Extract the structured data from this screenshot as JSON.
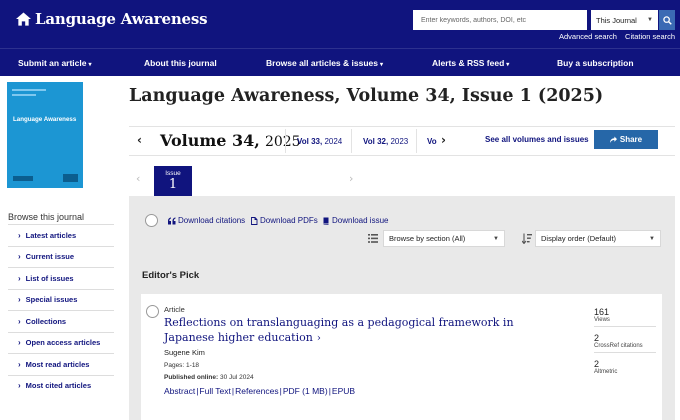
{
  "header": {
    "journal_name": "Language Awareness",
    "search_placeholder": "Enter keywords, authors, DOI, etc",
    "search_scope": "This Journal",
    "advanced_search": "Advanced search",
    "citation_search": "Citation search"
  },
  "nav": [
    {
      "label": "Submit an article",
      "has_dropdown": true
    },
    {
      "label": "About this journal",
      "has_dropdown": false
    },
    {
      "label": "Browse all articles & issues",
      "has_dropdown": true
    },
    {
      "label": "Alerts & RSS feed",
      "has_dropdown": true
    },
    {
      "label": "Buy a subscription",
      "has_dropdown": false
    }
  ],
  "cover": {
    "title": "Language Awareness"
  },
  "sidebar": {
    "title": "Browse this journal",
    "items": [
      {
        "label": "Latest articles"
      },
      {
        "label": "Current issue"
      },
      {
        "label": "List of issues"
      },
      {
        "label": "Special issues"
      },
      {
        "label": "Collections"
      },
      {
        "label": "Open access articles"
      },
      {
        "label": "Most read articles"
      },
      {
        "label": "Most cited articles"
      }
    ]
  },
  "page": {
    "title": "Language Awareness, Volume 34, Issue 1 (2025)"
  },
  "volumes": {
    "current_label": "Volume 34,",
    "current_year": "2025",
    "items": [
      {
        "label": "Vol 33,",
        "year": "2024"
      },
      {
        "label": "Vol 32,",
        "year": "2023"
      },
      {
        "label": "Vo",
        "year": ""
      }
    ],
    "see_all": "See all volumes and issues",
    "share": "Share"
  },
  "issue_tab": {
    "label": "Issue",
    "number": "1"
  },
  "toolbar": {
    "download_citations": "Download citations",
    "download_pdfs": "Download PDFs",
    "download_issue": "Download issue",
    "browse_by": "Browse by section (All)",
    "display_order": "Display order (Default)"
  },
  "section": {
    "title": "Editor's Pick"
  },
  "article": {
    "type": "Article",
    "title": "Reflections on translanguaging as a pedagogical framework in Japanese higher education",
    "author": "Sugene Kim",
    "pages": "Pages: 1-18",
    "published_label": "Published online:",
    "published_date": "30 Jul 2024",
    "links": [
      "Abstract",
      "Full Text",
      "References",
      "PDF (1 MB)",
      "EPUB"
    ],
    "metrics": [
      {
        "value": "161",
        "label": "Views"
      },
      {
        "value": "2",
        "label": "CrossRef citations"
      },
      {
        "value": "2",
        "label": "Altmetric"
      }
    ]
  },
  "colors": {
    "brand_navy": "#10147e",
    "share_blue": "#2667a8",
    "cover_blue": "#1c96d3",
    "panel_gray": "#e9e9e9"
  }
}
